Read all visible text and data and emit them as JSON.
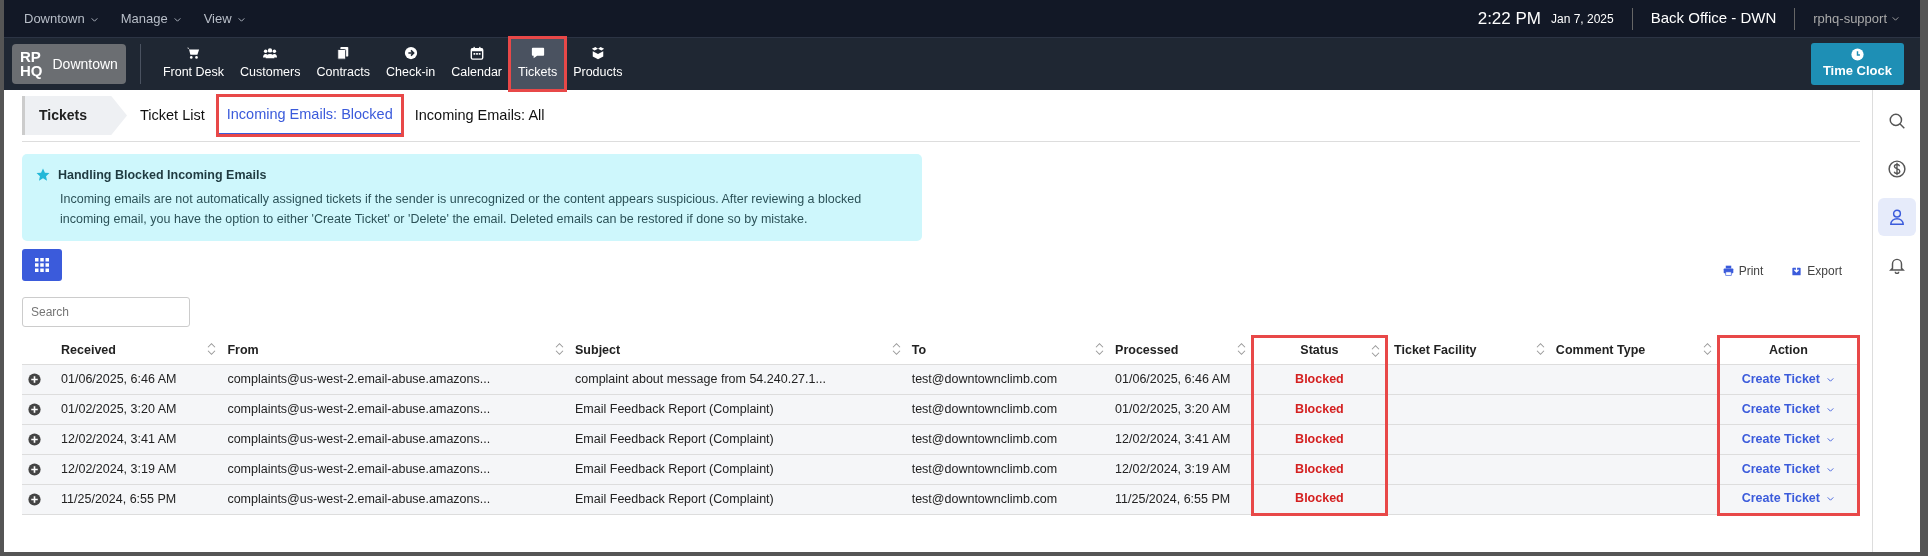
{
  "top_menu": [
    {
      "label": "Downtown"
    },
    {
      "label": "Manage"
    },
    {
      "label": "View"
    }
  ],
  "clock": {
    "time": "2:22 PM",
    "date": "Jan 7, 2025"
  },
  "location": "Back Office - DWN",
  "user": "rphq-support",
  "logo": {
    "mark_top": "RP",
    "mark_bottom": "HQ",
    "label": "Downtown"
  },
  "nav": [
    {
      "label": "Front Desk",
      "selected": false,
      "highlighted": false
    },
    {
      "label": "Customers",
      "selected": false,
      "highlighted": false
    },
    {
      "label": "Contracts",
      "selected": false,
      "highlighted": false
    },
    {
      "label": "Check-in",
      "selected": false,
      "highlighted": false
    },
    {
      "label": "Calendar",
      "selected": false,
      "highlighted": false
    },
    {
      "label": "Tickets",
      "selected": true,
      "highlighted": true
    },
    {
      "label": "Products",
      "selected": false,
      "highlighted": false
    }
  ],
  "time_clock": "Time Clock",
  "breadcrumb": "Tickets",
  "tabs": [
    {
      "label": "Ticket List",
      "selected": false,
      "highlighted": false
    },
    {
      "label": "Incoming Emails: Blocked",
      "selected": true,
      "highlighted": true
    },
    {
      "label": "Incoming Emails: All",
      "selected": false,
      "highlighted": false
    }
  ],
  "notice": {
    "title": "Handling Blocked Incoming Emails",
    "body": "Incoming emails are not automatically assigned tickets if the sender is unrecognized or the content appears suspicious. After reviewing a blocked incoming email, you have the option to either 'Create Ticket' or 'Delete' the email. Deleted emails can be restored if done so by mistake."
  },
  "toolbar": [
    {
      "label": "Print"
    },
    {
      "label": "Export"
    }
  ],
  "search": {
    "placeholder": "Search"
  },
  "table": {
    "columns": [
      {
        "label": "Received",
        "sortable": true,
        "highlighted": false
      },
      {
        "label": "From",
        "sortable": true,
        "highlighted": false
      },
      {
        "label": "Subject",
        "sortable": true,
        "highlighted": false
      },
      {
        "label": "To",
        "sortable": true,
        "highlighted": false
      },
      {
        "label": "Processed",
        "sortable": true,
        "highlighted": false
      },
      {
        "label": "Status",
        "sortable": true,
        "highlighted": true
      },
      {
        "label": "Ticket Facility",
        "sortable": true,
        "highlighted": false
      },
      {
        "label": "Comment Type",
        "sortable": true,
        "highlighted": false
      },
      {
        "label": "Action",
        "sortable": false,
        "highlighted": true
      }
    ],
    "rows": [
      {
        "received": "01/06/2025, 6:46 AM",
        "from": "complaints@us-west-2.email-abuse.amazons...",
        "subject": "complaint about message from 54.240.27.1...",
        "to": "test@downtownclimb.com",
        "processed": "01/06/2025, 6:46 AM",
        "status": "Blocked",
        "action": "Create Ticket"
      },
      {
        "received": "01/02/2025, 3:20 AM",
        "from": "complaints@us-west-2.email-abuse.amazons...",
        "subject": "Email Feedback Report (Complaint)",
        "to": "test@downtownclimb.com",
        "processed": "01/02/2025, 3:20 AM",
        "status": "Blocked",
        "action": "Create Ticket"
      },
      {
        "received": "12/02/2024, 3:41 AM",
        "from": "complaints@us-west-2.email-abuse.amazons...",
        "subject": "Email Feedback Report (Complaint)",
        "to": "test@downtownclimb.com",
        "processed": "12/02/2024, 3:41 AM",
        "status": "Blocked",
        "action": "Create Ticket"
      },
      {
        "received": "12/02/2024, 3:19 AM",
        "from": "complaints@us-west-2.email-abuse.amazons...",
        "subject": "Email Feedback Report (Complaint)",
        "to": "test@downtownclimb.com",
        "processed": "12/02/2024, 3:19 AM",
        "status": "Blocked",
        "action": "Create Ticket"
      },
      {
        "received": "11/25/2024, 6:55 PM",
        "from": "complaints@us-west-2.email-abuse.amazons...",
        "subject": "Email Feedback Report (Complaint)",
        "to": "test@downtownclimb.com",
        "processed": "11/25/2024, 6:55 PM",
        "status": "Blocked",
        "action": "Create Ticket"
      }
    ]
  },
  "sidebar": [
    {
      "selected": false
    },
    {
      "selected": false
    },
    {
      "selected": true
    },
    {
      "selected": false
    }
  ]
}
